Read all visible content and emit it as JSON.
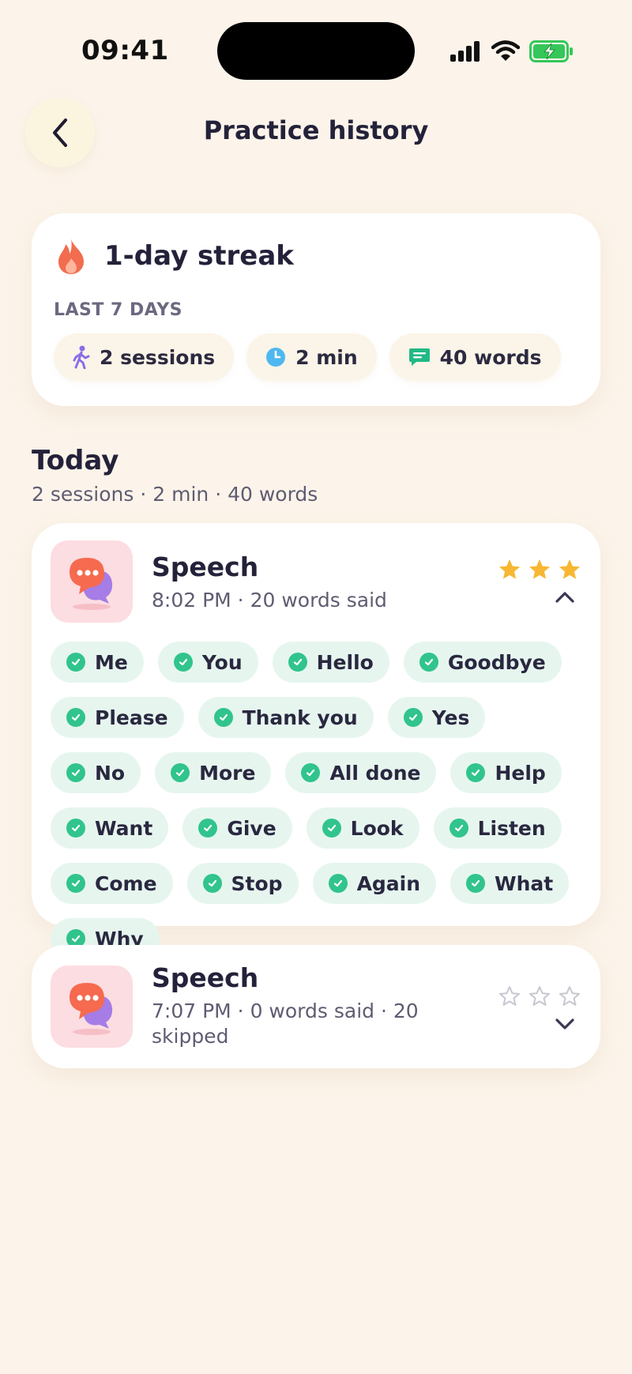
{
  "status_bar": {
    "time": "09:41"
  },
  "header": {
    "title": "Practice history"
  },
  "streak": {
    "title": "1-day streak",
    "period_label": "LAST 7 DAYS",
    "stats": [
      {
        "icon": "walking-person-icon",
        "label": "2 sessions"
      },
      {
        "icon": "clock-icon",
        "label": "2 min"
      },
      {
        "icon": "chat-bubble-icon",
        "label": "40 words"
      }
    ]
  },
  "today": {
    "title": "Today",
    "summary": "2 sessions · 2 min · 40 words",
    "sessions": [
      {
        "name": "Speech",
        "meta": "8:02 PM · 20 words said",
        "stars_filled": 3,
        "stars_total": 3,
        "expanded": true,
        "words": [
          "Me",
          "You",
          "Hello",
          "Goodbye",
          "Please",
          "Thank you",
          "Yes",
          "No",
          "More",
          "All done",
          "Help",
          "Want",
          "Give",
          "Look",
          "Listen",
          "Come",
          "Stop",
          "Again",
          "What",
          "Why"
        ]
      },
      {
        "name": "Speech",
        "meta": "7:07 PM · 0 words said · 20 skipped",
        "stars_filled": 0,
        "stars_total": 3,
        "expanded": false
      }
    ]
  },
  "colors": {
    "background": "#fcf4ea",
    "star_filled": "#f7b733",
    "star_empty": "#c9c6d0",
    "check_green": "#31c48d",
    "chip_bg": "#e6f6ef",
    "flame": "#f26d4f"
  }
}
